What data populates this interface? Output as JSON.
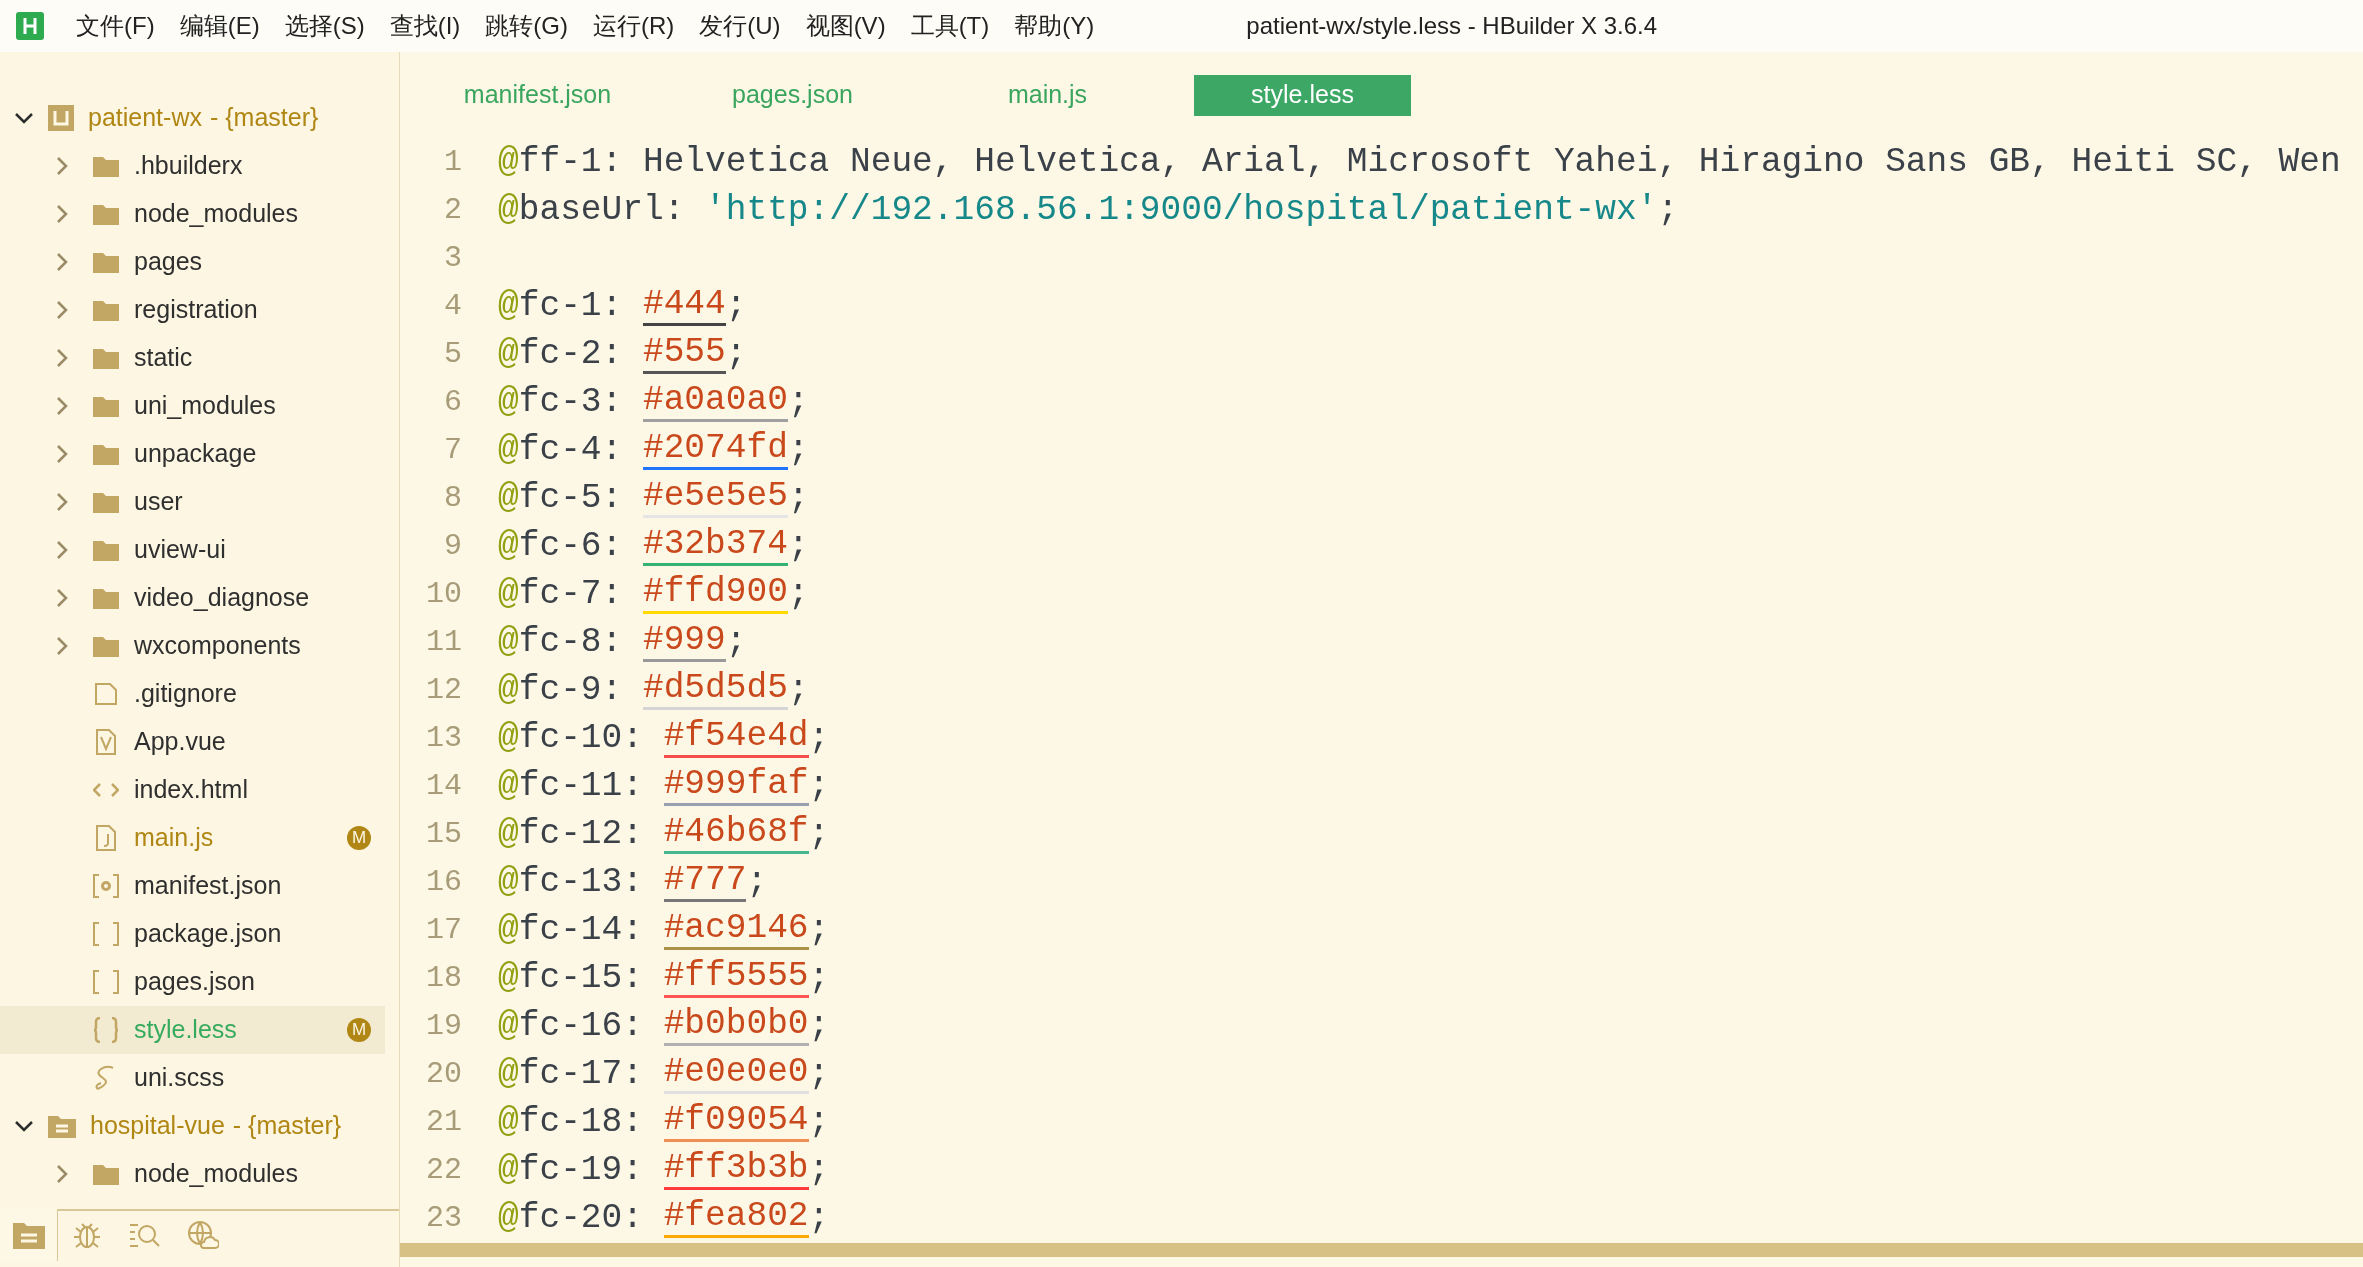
{
  "menu": [
    {
      "label": "文件(F)"
    },
    {
      "label": "编辑(E)"
    },
    {
      "label": "选择(S)"
    },
    {
      "label": "查找(I)"
    },
    {
      "label": "跳转(G)"
    },
    {
      "label": "运行(R)"
    },
    {
      "label": "发行(U)"
    },
    {
      "label": "视图(V)"
    },
    {
      "label": "工具(T)"
    },
    {
      "label": "帮助(Y)"
    }
  ],
  "window": {
    "title": "patient-wx/style.less - HBuilder X 3.6.4"
  },
  "tree": [
    {
      "name": "patient-wx",
      "branch": "- {master}",
      "kind": "project",
      "expanded": true,
      "children": [
        {
          "name": ".hbuilderx",
          "kind": "folder",
          "expanded": false,
          "selected": false,
          "modified": false
        },
        {
          "name": "node_modules",
          "kind": "folder",
          "expanded": false,
          "selected": false,
          "modified": false
        },
        {
          "name": "pages",
          "kind": "folder",
          "expanded": false,
          "selected": false,
          "modified": false
        },
        {
          "name": "registration",
          "kind": "folder",
          "expanded": false,
          "selected": false,
          "modified": false
        },
        {
          "name": "static",
          "kind": "folder",
          "expanded": false,
          "selected": false,
          "modified": false
        },
        {
          "name": "uni_modules",
          "kind": "folder",
          "expanded": false,
          "selected": false,
          "modified": false
        },
        {
          "name": "unpackage",
          "kind": "folder",
          "expanded": false,
          "selected": false,
          "modified": false
        },
        {
          "name": "user",
          "kind": "folder",
          "expanded": false,
          "selected": false,
          "modified": false
        },
        {
          "name": "uview-ui",
          "kind": "folder",
          "expanded": false,
          "selected": false,
          "modified": false
        },
        {
          "name": "video_diagnose",
          "kind": "folder",
          "expanded": false,
          "selected": false,
          "modified": false
        },
        {
          "name": "wxcomponents",
          "kind": "folder",
          "expanded": false,
          "selected": false,
          "modified": false
        },
        {
          "name": ".gitignore",
          "kind": "file",
          "selected": false,
          "modified": false
        },
        {
          "name": "App.vue",
          "kind": "vue",
          "selected": false,
          "modified": false
        },
        {
          "name": "index.html",
          "kind": "html",
          "selected": false,
          "modified": false
        },
        {
          "name": "main.js",
          "kind": "js",
          "selected": false,
          "modified": true,
          "badge": "M"
        },
        {
          "name": "manifest.json",
          "kind": "settings",
          "selected": false,
          "modified": false
        },
        {
          "name": "package.json",
          "kind": "json",
          "selected": false,
          "modified": false
        },
        {
          "name": "pages.json",
          "kind": "json",
          "selected": false,
          "modified": false
        },
        {
          "name": "style.less",
          "kind": "less",
          "selected": true,
          "modified": true,
          "badge": "M"
        },
        {
          "name": "uni.scss",
          "kind": "scss",
          "selected": false,
          "modified": false
        }
      ]
    },
    {
      "name": "hospital-vue",
      "branch": "- {master}",
      "kind": "web",
      "expanded": true,
      "children": [
        {
          "name": "node_modules",
          "kind": "folder",
          "expanded": false,
          "selected": false,
          "modified": false
        }
      ]
    }
  ],
  "sidebar_tabs": [
    {
      "kind": "project",
      "selected": true
    },
    {
      "kind": "debug",
      "selected": false
    },
    {
      "kind": "search",
      "selected": false
    },
    {
      "kind": "web",
      "selected": false
    }
  ],
  "tabs": [
    {
      "label": "manifest.json",
      "selected": false
    },
    {
      "label": "pages.json",
      "selected": false
    },
    {
      "label": "main.js",
      "selected": false
    },
    {
      "label": "style.less",
      "selected": true
    }
  ],
  "lines": [
    {
      "num": "1",
      "kind": "text",
      "sigil": "@",
      "name": "ff-1:",
      "value": "Helvetica Neue, Helvetica, Arial, Microsoft Yahei, Hiragino Sans GB, Heiti SC, Wen"
    },
    {
      "num": "2",
      "kind": "string",
      "sigil": "@",
      "name": "baseUrl:",
      "value": "'http://192.168.56.1:9000/hospital/patient-wx'",
      "end": ";"
    },
    {
      "num": "3",
      "kind": "blank"
    },
    {
      "num": "4",
      "kind": "color",
      "sigil": "@",
      "name": "fc-1:",
      "value": "#444",
      "end": ";",
      "color": "#444444"
    },
    {
      "num": "5",
      "kind": "color",
      "sigil": "@",
      "name": "fc-2:",
      "value": "#555",
      "end": ";",
      "color": "#555555"
    },
    {
      "num": "6",
      "kind": "color",
      "sigil": "@",
      "name": "fc-3:",
      "value": "#a0a0a0",
      "end": ";",
      "color": "#a0a0a0"
    },
    {
      "num": "7",
      "kind": "color",
      "sigil": "@",
      "name": "fc-4:",
      "value": "#2074fd",
      "end": ";",
      "color": "#2074fd"
    },
    {
      "num": "8",
      "kind": "color",
      "sigil": "@",
      "name": "fc-5:",
      "value": "#e5e5e5",
      "end": ";",
      "color": "#e5e5e5"
    },
    {
      "num": "9",
      "kind": "color",
      "sigil": "@",
      "name": "fc-6:",
      "value": "#32b374",
      "end": ";",
      "color": "#32b374"
    },
    {
      "num": "10",
      "kind": "color",
      "sigil": "@",
      "name": "fc-7:",
      "value": "#ffd900",
      "end": ";",
      "color": "#ffd900"
    },
    {
      "num": "11",
      "kind": "color",
      "sigil": "@",
      "name": "fc-8:",
      "value": "#999",
      "end": ";",
      "color": "#999999"
    },
    {
      "num": "12",
      "kind": "color",
      "sigil": "@",
      "name": "fc-9:",
      "value": "#d5d5d5",
      "end": ";",
      "color": "#d5d5d5"
    },
    {
      "num": "13",
      "kind": "color",
      "sigil": "@",
      "name": "fc-10:",
      "value": "#f54e4d",
      "end": ";",
      "color": "#f54e4d"
    },
    {
      "num": "14",
      "kind": "color",
      "sigil": "@",
      "name": "fc-11:",
      "value": "#999faf",
      "end": ";",
      "color": "#999faf"
    },
    {
      "num": "15",
      "kind": "color",
      "sigil": "@",
      "name": "fc-12:",
      "value": "#46b68f",
      "end": ";",
      "color": "#46b68f"
    },
    {
      "num": "16",
      "kind": "color",
      "sigil": "@",
      "name": "fc-13:",
      "value": "#777",
      "end": ";",
      "color": "#777777"
    },
    {
      "num": "17",
      "kind": "color",
      "sigil": "@",
      "name": "fc-14:",
      "value": "#ac9146",
      "end": ";",
      "color": "#ac9146"
    },
    {
      "num": "18",
      "kind": "color",
      "sigil": "@",
      "name": "fc-15:",
      "value": "#ff5555",
      "end": ";",
      "color": "#ff5555"
    },
    {
      "num": "19",
      "kind": "color",
      "sigil": "@",
      "name": "fc-16:",
      "value": "#b0b0b0",
      "end": ";",
      "color": "#b0b0b0"
    },
    {
      "num": "20",
      "kind": "color",
      "sigil": "@",
      "name": "fc-17:",
      "value": "#e0e0e0",
      "end": ";",
      "color": "#e0e0e0"
    },
    {
      "num": "21",
      "kind": "color",
      "sigil": "@",
      "name": "fc-18:",
      "value": "#f09054",
      "end": ";",
      "color": "#f09054"
    },
    {
      "num": "22",
      "kind": "color",
      "sigil": "@",
      "name": "fc-19:",
      "value": "#ff3b3b",
      "end": ";",
      "color": "#ff3b3b"
    },
    {
      "num": "23",
      "kind": "color",
      "sigil": "@",
      "name": "fc-20:",
      "value": "#fea802",
      "end": ";",
      "color": "#fea802"
    }
  ]
}
